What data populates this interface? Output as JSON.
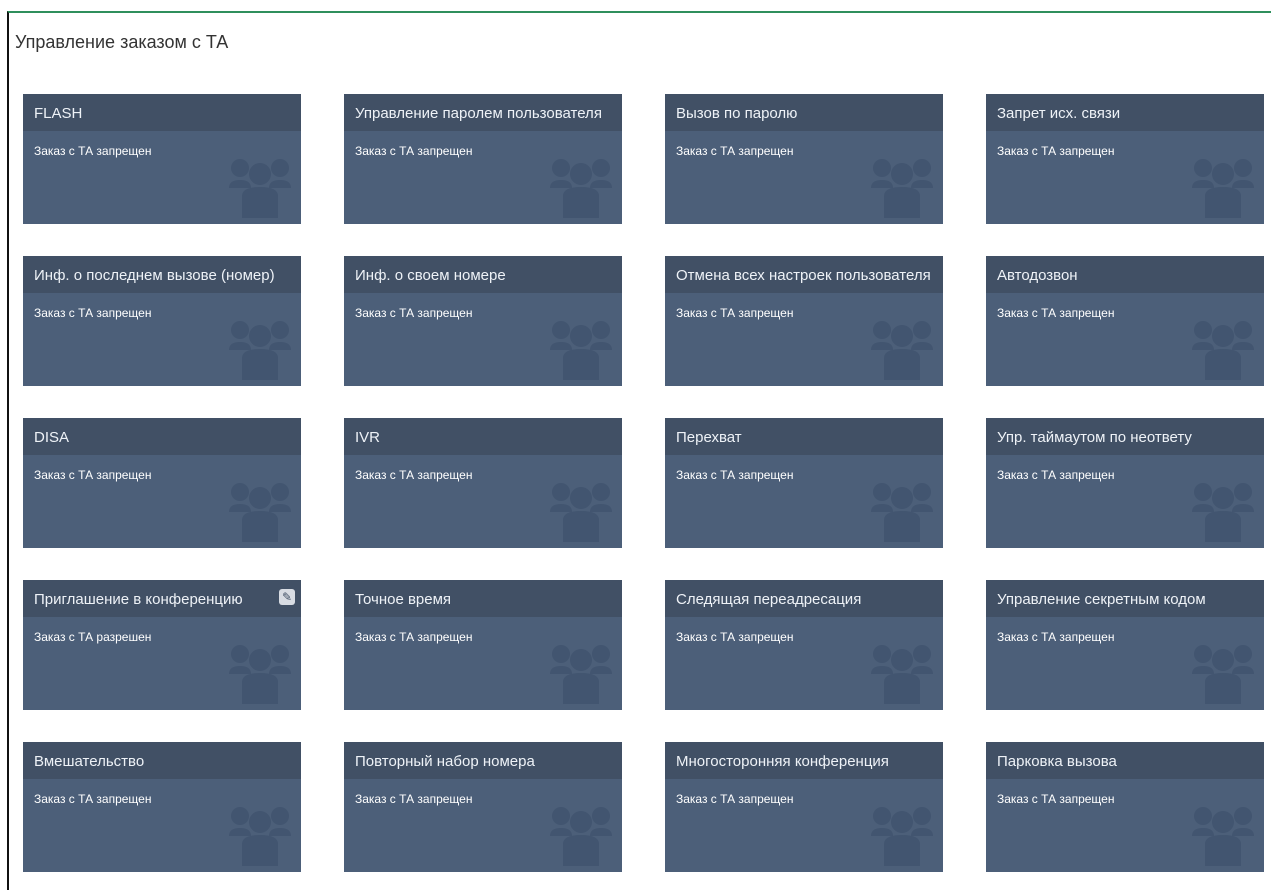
{
  "panel": {
    "title": "Управление заказом с ТА"
  },
  "cards": [
    {
      "title": "FLASH",
      "status": "Заказ с ТА запрещен"
    },
    {
      "title": "Управление паролем пользователя",
      "status": "Заказ с ТА запрещен"
    },
    {
      "title": "Вызов по паролю",
      "status": "Заказ с ТА запрещен"
    },
    {
      "title": "Запрет исх. связи",
      "status": "Заказ с ТА запрещен"
    },
    {
      "title": "Инф. о последнем вызове (номер)",
      "status": "Заказ с ТА запрещен"
    },
    {
      "title": "Инф. о своем номере",
      "status": "Заказ с ТА запрещен"
    },
    {
      "title": "Отмена всех настроек пользователя",
      "status": "Заказ с ТА запрещен"
    },
    {
      "title": "Автодозвон",
      "status": "Заказ с ТА запрещен"
    },
    {
      "title": "DISA",
      "status": "Заказ с ТА запрещен"
    },
    {
      "title": "IVR",
      "status": "Заказ с ТА запрещен"
    },
    {
      "title": "Перехват",
      "status": "Заказ с ТА запрещен"
    },
    {
      "title": "Упр. таймаутом по неответу",
      "status": "Заказ с ТА запрещен"
    },
    {
      "title": "Приглашение в конференцию",
      "status": "Заказ с ТА разрешен"
    },
    {
      "title": "Точное время",
      "status": "Заказ с ТА запрещен"
    },
    {
      "title": "Следящая переадресация",
      "status": "Заказ с ТА запрещен"
    },
    {
      "title": "Управление секретным кодом",
      "status": "Заказ с ТА запрещен"
    },
    {
      "title": "Вмешательство",
      "status": "Заказ с ТА запрещен"
    },
    {
      "title": "Повторный набор номера",
      "status": "Заказ с ТА запрещен"
    },
    {
      "title": "Многосторонняя конференция",
      "status": "Заказ с ТА запрещен"
    },
    {
      "title": "Парковка вызова",
      "status": "Заказ с ТА запрещен"
    }
  ],
  "icons": {
    "card_icon": "people-group-icon",
    "edit_icon": "edit-icon"
  },
  "colors": {
    "card_bg": "#4c5f79",
    "card_header_bg": "#415065",
    "accent_border": "#2f8f5c"
  }
}
